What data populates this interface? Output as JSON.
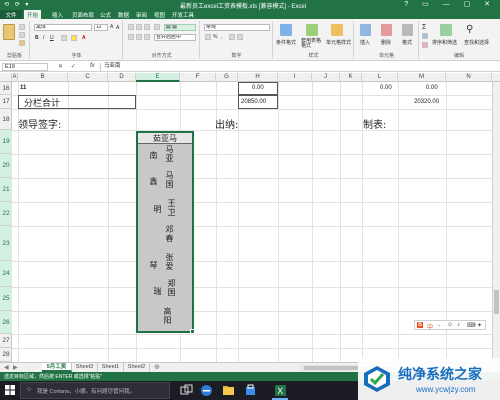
{
  "titlebar": {
    "title": "最新员工excel工资表模板.xls [兼容模式] - Excel",
    "quick_access": "⟲ ⟳ ▾",
    "window_controls": "? ▭ — ▢ ✕"
  },
  "ribbon_tabs": [
    "文件",
    "开始",
    "插入",
    "页面布局",
    "公式",
    "数据",
    "审阅",
    "视图",
    "开发工具"
  ],
  "ribbon": {
    "font_name": "黑体",
    "font_size": "12",
    "number_format": "常规",
    "merge_label": "合并后居中",
    "groups": [
      "剪贴板",
      "字体",
      "对齐方式",
      "数字",
      "样式",
      "单元格",
      "编辑"
    ],
    "styles_buttons": [
      "条件格式",
      "套用表格格式",
      "单元格样式"
    ],
    "cells_buttons": [
      "插入",
      "删除",
      "格式"
    ],
    "edit_buttons": [
      "排序和筛选",
      "查找和选择"
    ]
  },
  "formula_bar": {
    "name_box": "E19",
    "fx_icons": "✕ ✓",
    "fx": "fx",
    "value": "马亚南"
  },
  "columns": [
    "A",
    "B",
    "C",
    "D",
    "E",
    "F",
    "G",
    "H",
    "I",
    "J",
    "K",
    "L",
    "M",
    "N"
  ],
  "rows": [
    "16",
    "17",
    "18",
    "19",
    "20",
    "21",
    "22",
    "23",
    "24",
    "25",
    "26",
    "27",
    "28"
  ],
  "cells": {
    "a16": "11",
    "h16": "0.00",
    "l16": "0.00",
    "m16": "0.00",
    "b17": "分栏合计",
    "h17": "20850.00",
    "m17": "20320.00",
    "leader_sign": "领导签字:",
    "cashier": "出纳:",
    "preparer": "制表:"
  },
  "names_block": {
    "header": "茹亚马",
    "names": [
      {
        "given": "南",
        "family": "马亚"
      },
      {
        "given": "鑫",
        "family": "马国"
      },
      {
        "given": "明",
        "family": "王卫"
      },
      {
        "given": "",
        "family": "邓春"
      },
      {
        "given": "琴",
        "family": "张爱"
      },
      {
        "given": "瑞",
        "family": "郑国"
      },
      {
        "given": "",
        "family": "高阳"
      }
    ]
  },
  "sheet_tabs": [
    "5月工资",
    "Sheet3",
    "Sheet1",
    "Sheet2"
  ],
  "add_sheet": "⊕",
  "status": "选定目标区域，然后按 ENTER 或选择“粘贴”",
  "taskbar": {
    "search_placeholder": "我是 Cortana，小娜。有问题尽管问我。"
  },
  "watermark": {
    "title": "纯净系统之家",
    "url": "www.ycwjzy.com"
  },
  "colors": {
    "excel_green": "#217346",
    "selection_fill": "#c8c8c8",
    "taskbar": "#1c1c24"
  }
}
